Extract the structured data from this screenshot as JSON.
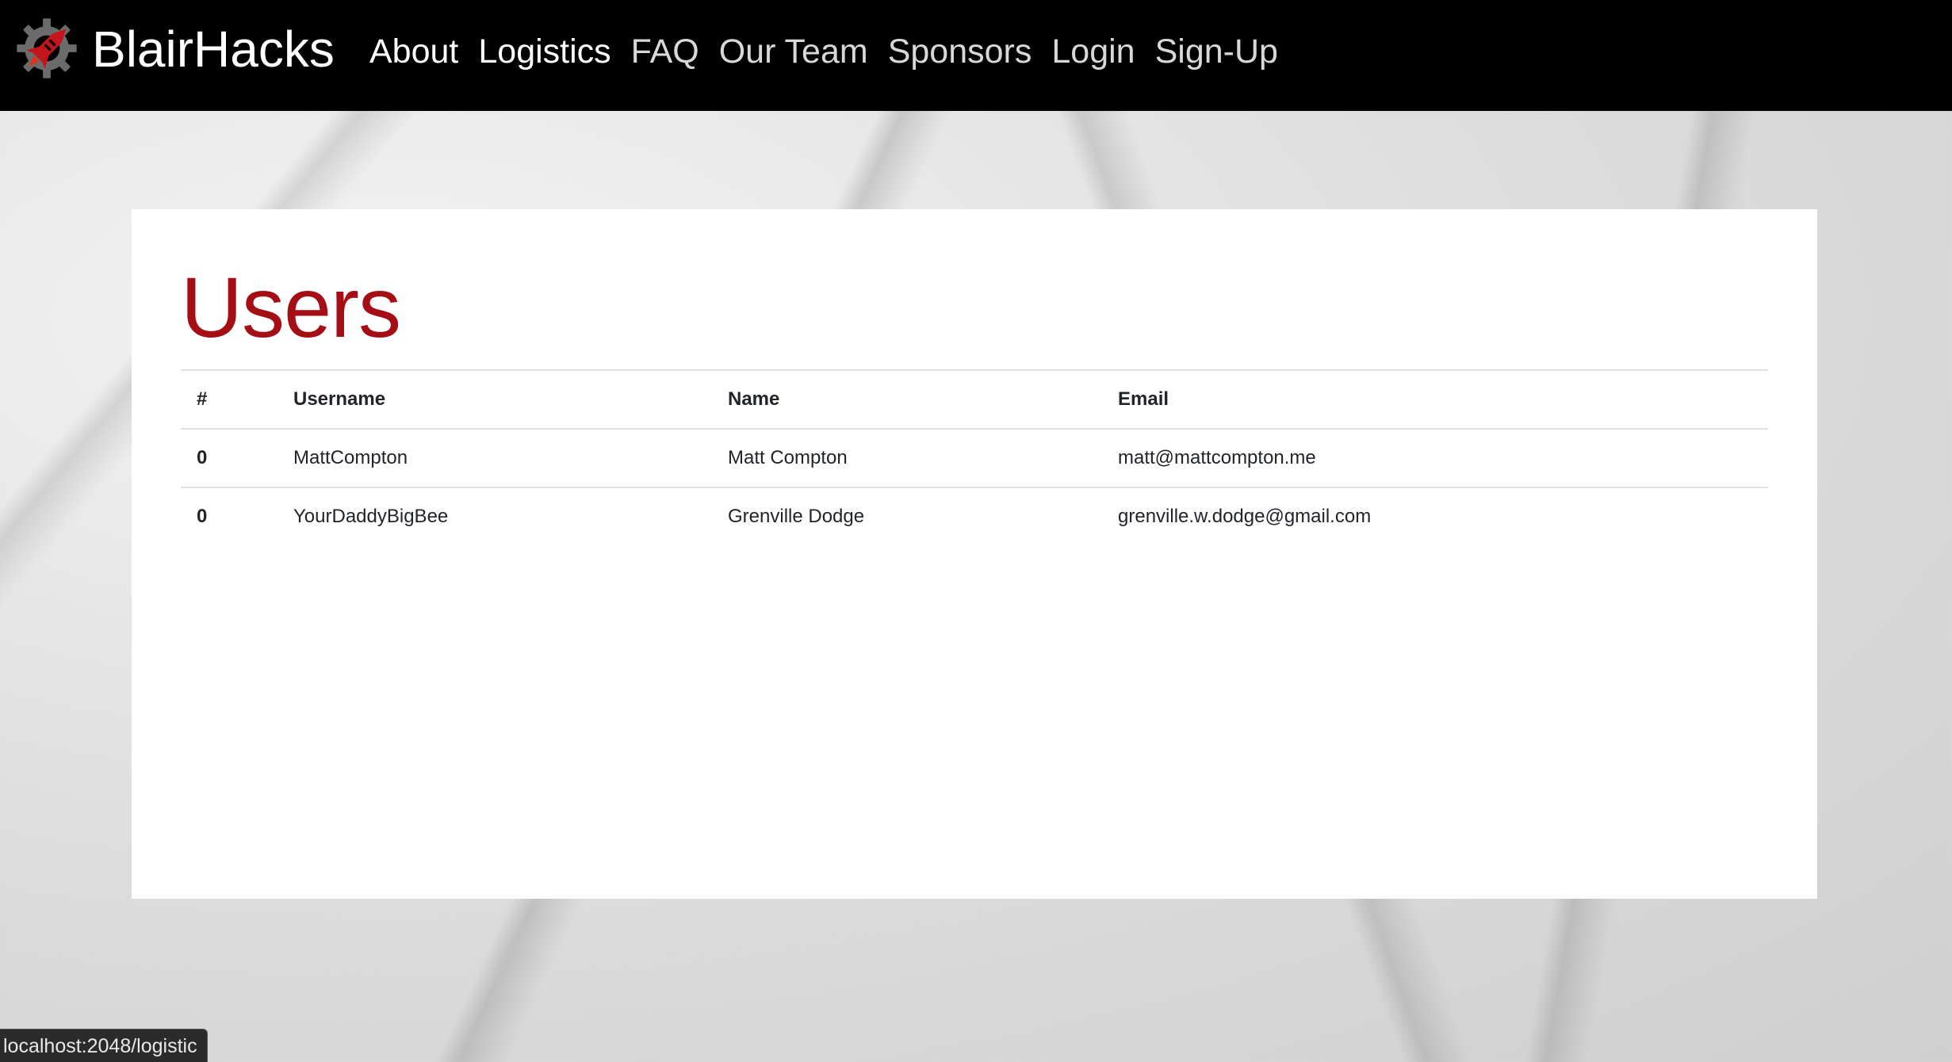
{
  "brand": {
    "name": "BlairHacks",
    "logo_icon": "rocket-gear-icon",
    "accent": "#a50e14"
  },
  "nav": {
    "items": [
      {
        "label": "About"
      },
      {
        "label": "Logistics"
      },
      {
        "label": "FAQ"
      },
      {
        "label": "Our Team"
      },
      {
        "label": "Sponsors"
      },
      {
        "label": "Login"
      },
      {
        "label": "Sign-Up"
      }
    ]
  },
  "page": {
    "title": "Users"
  },
  "table": {
    "headers": [
      "#",
      "Username",
      "Name",
      "Email"
    ],
    "rows": [
      [
        "0",
        "MattCompton",
        "Matt Compton",
        "matt@mattcompton.me"
      ],
      [
        "0",
        "YourDaddyBigBee",
        "Grenville Dodge",
        "grenville.w.dodge@gmail.com"
      ]
    ]
  },
  "status_bar": {
    "url": "localhost:2048/logistic"
  }
}
